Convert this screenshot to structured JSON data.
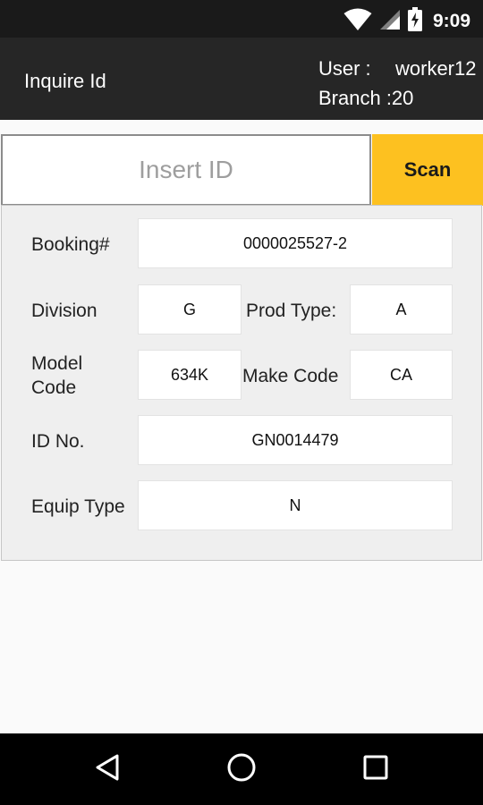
{
  "status_bar": {
    "time": "9:09",
    "icons": [
      "wifi-icon",
      "signal-icon",
      "battery-charging-icon"
    ]
  },
  "app_bar": {
    "title": "Inquire Id",
    "user_label": "User :",
    "user_value": "worker12",
    "branch_text": "Branch :20"
  },
  "scan": {
    "placeholder": "Insert ID",
    "value": "",
    "button_label": "Scan",
    "button_color": "#fdc120"
  },
  "details": {
    "booking_label": "Booking#",
    "booking_value": "0000025527-2",
    "division_label": "Division",
    "division_value": "G",
    "prod_type_label": "Prod Type:",
    "prod_type_value": "A",
    "model_code_label_line1": "Model",
    "model_code_label_line2": "Code",
    "model_code_value": "634K",
    "make_code_label": "Make Code",
    "make_code_value": "CA",
    "id_no_label": "ID No.",
    "id_no_value": "GN0014479",
    "equip_type_label": "Equip Type",
    "equip_type_value": "N"
  },
  "nav_bar": {
    "buttons": [
      "back-icon",
      "home-icon",
      "recents-icon"
    ]
  }
}
